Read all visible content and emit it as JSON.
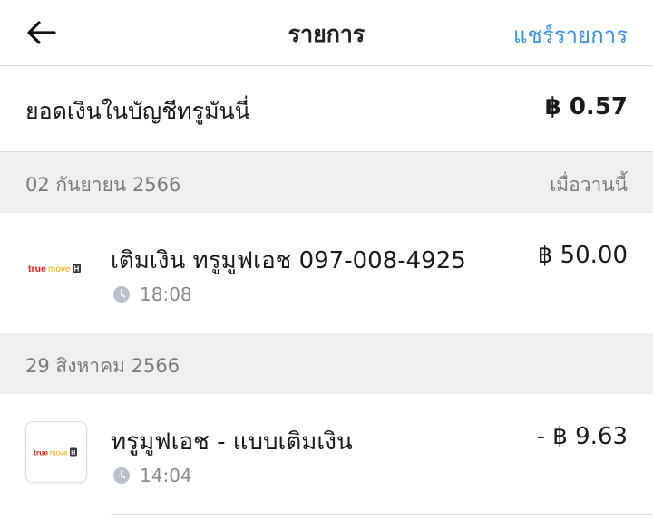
{
  "header": {
    "title": "รายการ",
    "share_label": "แชร์รายการ",
    "back_icon": "arrow-left-icon"
  },
  "balance": {
    "label": "ยอดเงินในบัญชีทรูมันนี่",
    "amount": "฿ 0.57"
  },
  "groups": [
    {
      "date": "02 กันยายน 2566",
      "note": "เมื่อวานนี้",
      "transactions": [
        {
          "logo": "truemove-h-logo",
          "logo_text": "truemove H",
          "title": "เติมเงิน ทรูมูฟเอช 097-008-4925",
          "time": "18:08",
          "amount": "฿ 50.00"
        }
      ]
    },
    {
      "date": "29 สิงหาคม 2566",
      "note": "",
      "transactions": [
        {
          "logo": "truemove-h-logo",
          "logo_text": "truemove H",
          "title": "ทรูมูฟเอช - แบบเติมเงิน",
          "time": "14:04",
          "amount": "- ฿ 9.63"
        }
      ]
    }
  ],
  "colors": {
    "accent": "#3b8fe8",
    "section_bg": "#efefef",
    "muted_text": "#7b7b7b",
    "brand_red": "#e2231a",
    "brand_yellow": "#f2a900"
  }
}
